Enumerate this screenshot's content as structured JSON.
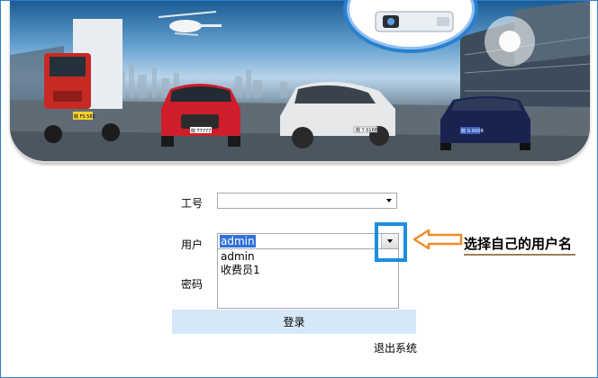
{
  "form": {
    "employee_id_label": "工号",
    "employee_id_value": "",
    "user_label": "用户",
    "user_value": "admin",
    "user_options": [
      "admin",
      "收费员1"
    ],
    "password_label": "密码"
  },
  "buttons": {
    "login_label": "登录",
    "exit_label": "退出系统"
  },
  "annotation": {
    "callout_text": "选择自己的用户名"
  },
  "banner": {
    "plates": [
      "皖 FS 582",
      "皖 T7777",
      "皖 Y 0168",
      "皖 G 6008"
    ]
  },
  "colors": {
    "accent_blue": "#1a8ee0",
    "window_border": "#2f7fd0",
    "selection": "#3070d8",
    "login_button_bg": "#d6e8f8",
    "callout_arrow": "#f08a2c"
  }
}
